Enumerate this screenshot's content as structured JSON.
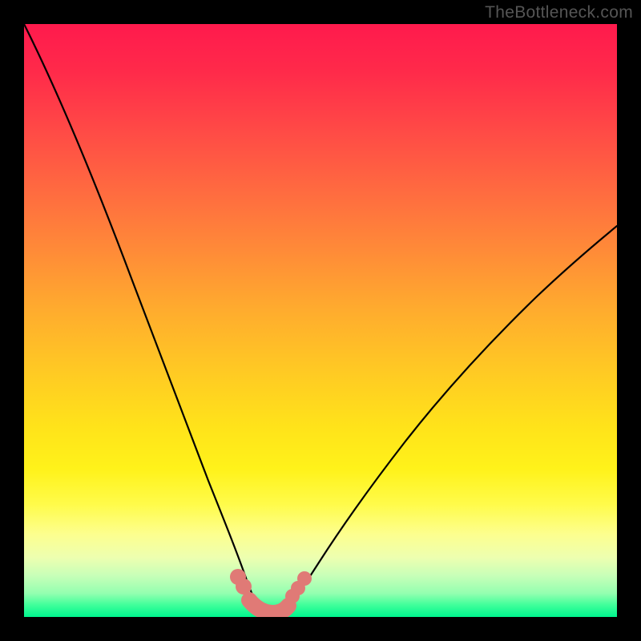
{
  "watermark": "TheBottleneck.com",
  "colors": {
    "background": "#000000",
    "gradient_top": "#ff1a4d",
    "gradient_bottom": "#00f58e",
    "curve": "#000000",
    "bead": "#e07a76"
  },
  "chart_data": {
    "type": "line",
    "title": "",
    "xlabel": "",
    "ylabel": "",
    "xlim": [
      0,
      100
    ],
    "ylim": [
      0,
      100
    ],
    "grid": false,
    "legend": false,
    "description": "Bottleneck curve: two branches plunging from high mismatch (top/red) to optimal match (bottom/green) at a single minimum, overlaid on a vertical red→yellow→green gradient encoding bottleneck severity.",
    "series": [
      {
        "name": "left-branch",
        "x": [
          0,
          4,
          8,
          12,
          16,
          20,
          24,
          27,
          30,
          32.5,
          35,
          36.5,
          38,
          39
        ],
        "y": [
          100,
          90,
          78,
          66,
          55,
          44,
          34,
          25,
          17,
          11,
          6,
          3.5,
          1.7,
          1
        ]
      },
      {
        "name": "right-branch",
        "x": [
          44,
          45.5,
          47.5,
          50,
          54,
          59,
          65,
          72,
          80,
          89,
          100
        ],
        "y": [
          1,
          2.3,
          4.5,
          7.5,
          12,
          18,
          25,
          33,
          42,
          52,
          63
        ]
      },
      {
        "name": "valley-floor",
        "x": [
          39,
          40.5,
          42,
          43,
          44
        ],
        "y": [
          1,
          0.6,
          0.5,
          0.6,
          1
        ]
      }
    ],
    "markers": {
      "description": "Salmon-colored beads near the valley on both slopes and along the floor.",
      "points": [
        {
          "x": 35.8,
          "y": 5.8
        },
        {
          "x": 36.8,
          "y": 4.2
        },
        {
          "x": 45.2,
          "y": 3.2
        },
        {
          "x": 46.0,
          "y": 4.2
        },
        {
          "x": 47.0,
          "y": 5.4
        }
      ],
      "floor_segment": {
        "x0": 37.8,
        "x1": 44.2,
        "y": 1.0
      }
    }
  }
}
